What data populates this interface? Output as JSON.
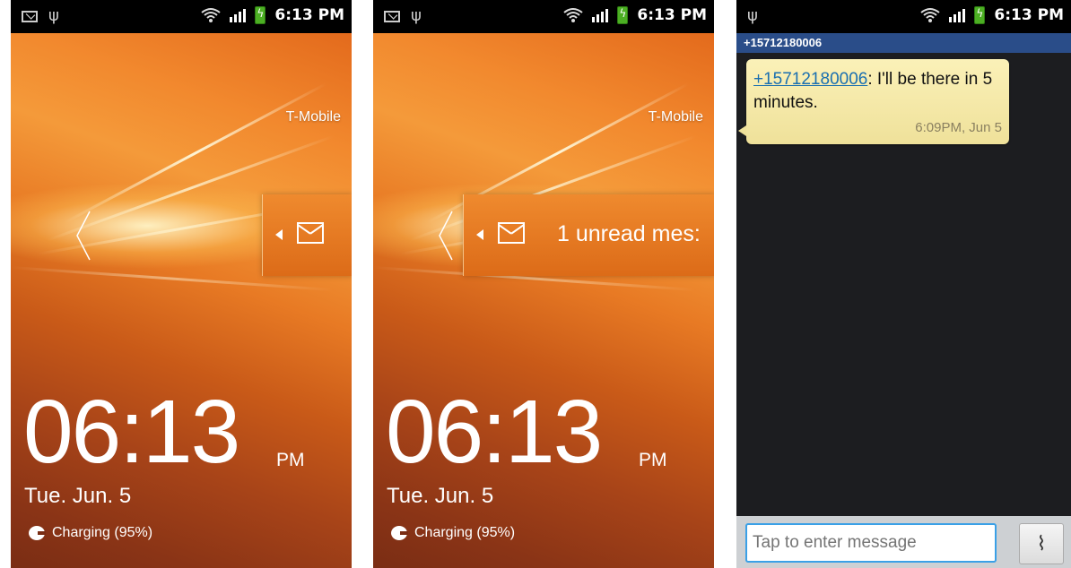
{
  "status_bar": {
    "time": "6:13 PM"
  },
  "lockscreen_1": {
    "carrier": "T-Mobile",
    "time": "06:13",
    "ampm": "PM",
    "date": "Tue. Jun. 5",
    "charging": "Charging (95%)"
  },
  "lockscreen_2": {
    "carrier": "T-Mobile",
    "notification_text": "1 unread mes:",
    "time": "06:13",
    "ampm": "PM",
    "date": "Tue. Jun. 5",
    "charging": "Charging (95%)"
  },
  "conversation": {
    "header": "+15712180006",
    "message": {
      "sender": "+15712180006",
      "body": ": I'll be there in 5 minutes.",
      "timestamp": "6:09PM, Jun 5"
    },
    "composer_placeholder": "Tap to enter message",
    "attach_icon": "paperclip-icon"
  },
  "colors": {
    "wallpaper_accent": "#e8802a",
    "header_blue": "#2a4d89",
    "bubble_yellow": "#f5e9a8",
    "link_blue": "#1a6fb0",
    "input_border": "#3aa0e6"
  }
}
